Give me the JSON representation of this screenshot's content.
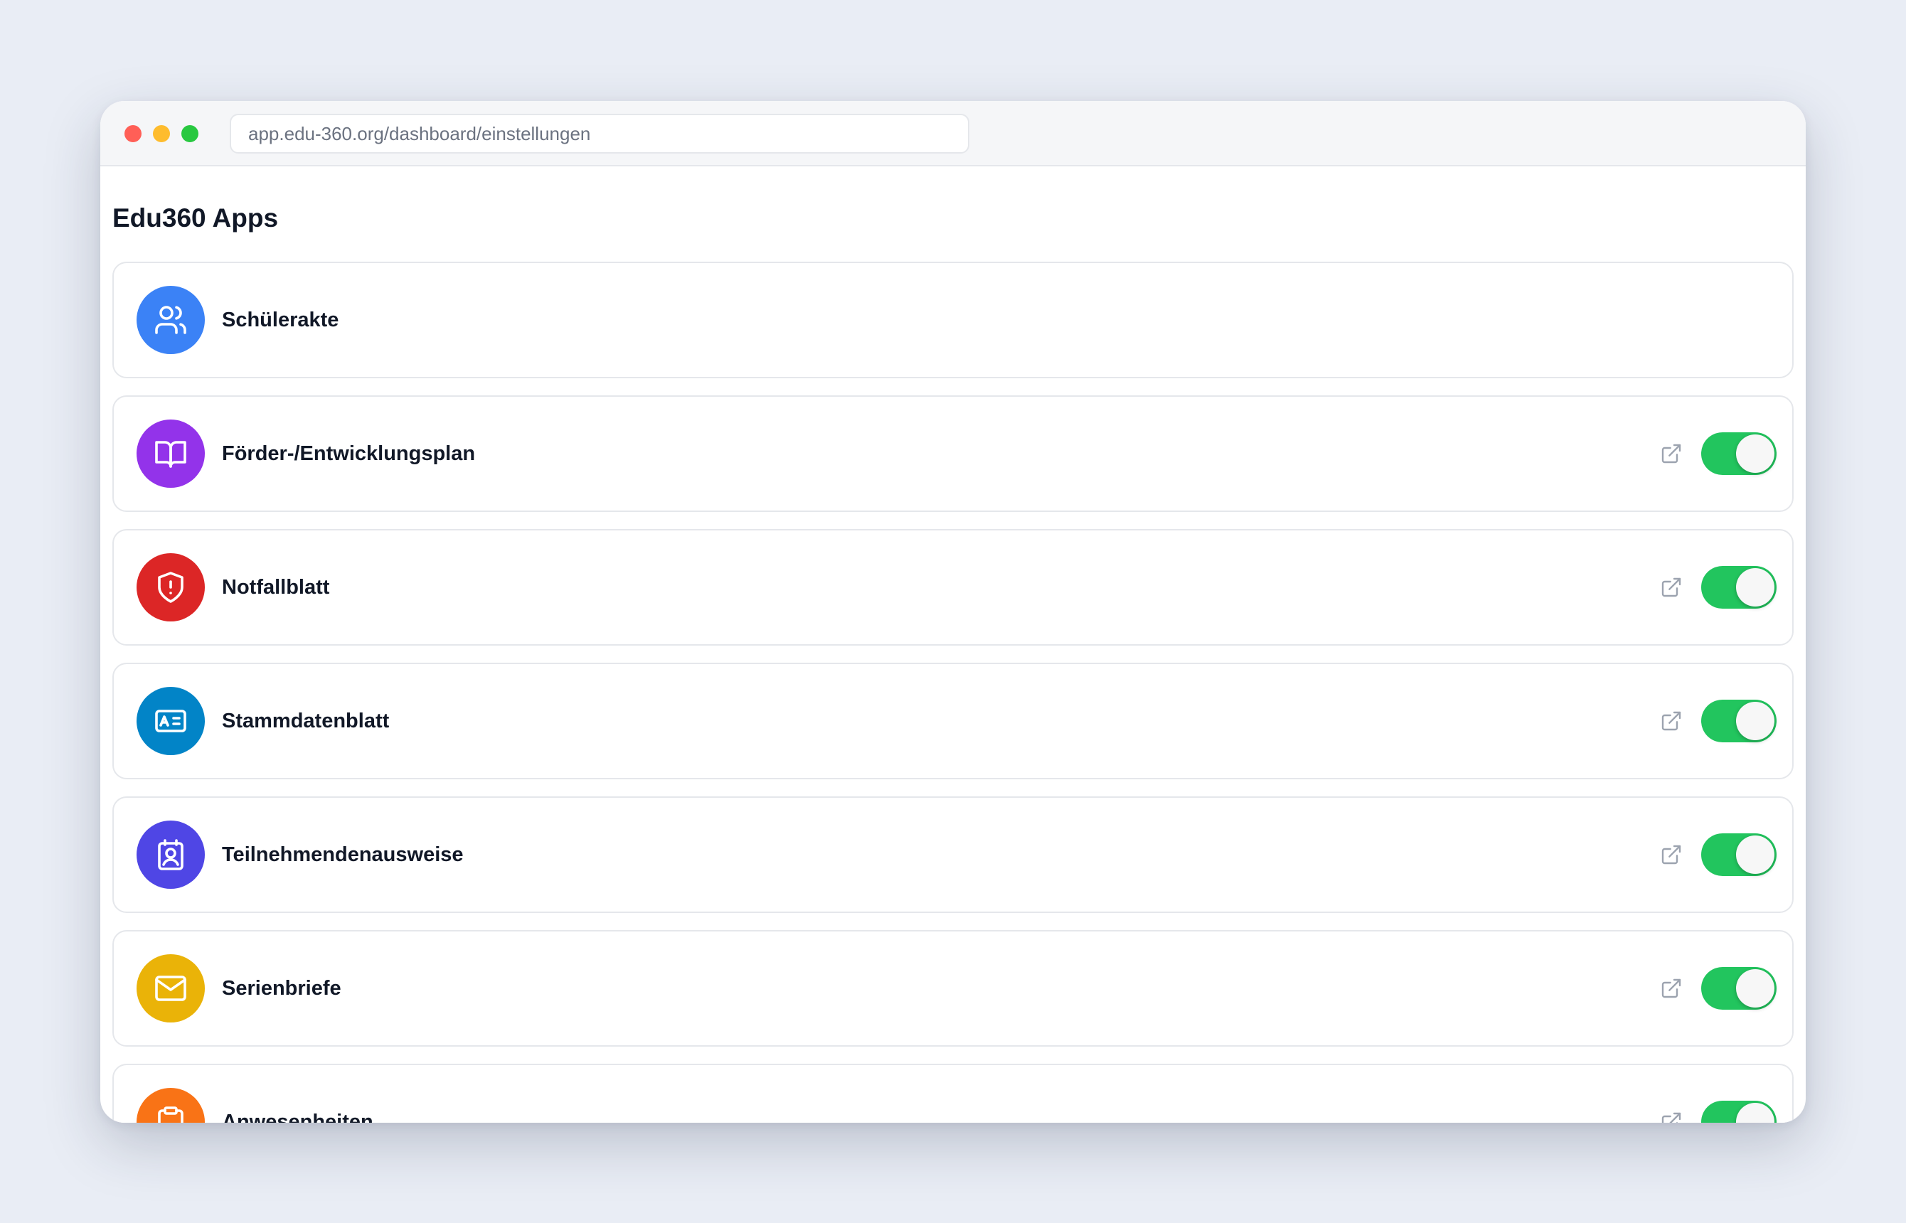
{
  "browser": {
    "url": "app.edu-360.org/dashboard/einstellungen"
  },
  "page": {
    "title": "Edu360 Apps"
  },
  "apps": [
    {
      "name": "Schülerakte",
      "icon": "users-icon",
      "color": "#3b82f6",
      "has_toggle": false,
      "enabled": null
    },
    {
      "name": "Förder-/Entwicklungsplan",
      "icon": "book-open-icon",
      "color": "#9333ea",
      "has_toggle": true,
      "enabled": true
    },
    {
      "name": "Notfallblatt",
      "icon": "shield-alert-icon",
      "color": "#dc2626",
      "has_toggle": true,
      "enabled": true
    },
    {
      "name": "Stammdatenblatt",
      "icon": "id-card-icon",
      "color": "#0284c7",
      "has_toggle": true,
      "enabled": true
    },
    {
      "name": "Teilnehmendenausweise",
      "icon": "badge-icon",
      "color": "#4f46e5",
      "has_toggle": true,
      "enabled": true
    },
    {
      "name": "Serienbriefe",
      "icon": "mail-icon",
      "color": "#eab308",
      "has_toggle": true,
      "enabled": true
    },
    {
      "name": "Anwesenheiten",
      "icon": "clipboard-icon",
      "color": "#f97316",
      "has_toggle": true,
      "enabled": true
    }
  ],
  "colors": {
    "toggle_on": "#22c55e",
    "card_border": "#e5e7eb",
    "text_primary": "#111827",
    "icon_muted": "#9ca3af"
  }
}
